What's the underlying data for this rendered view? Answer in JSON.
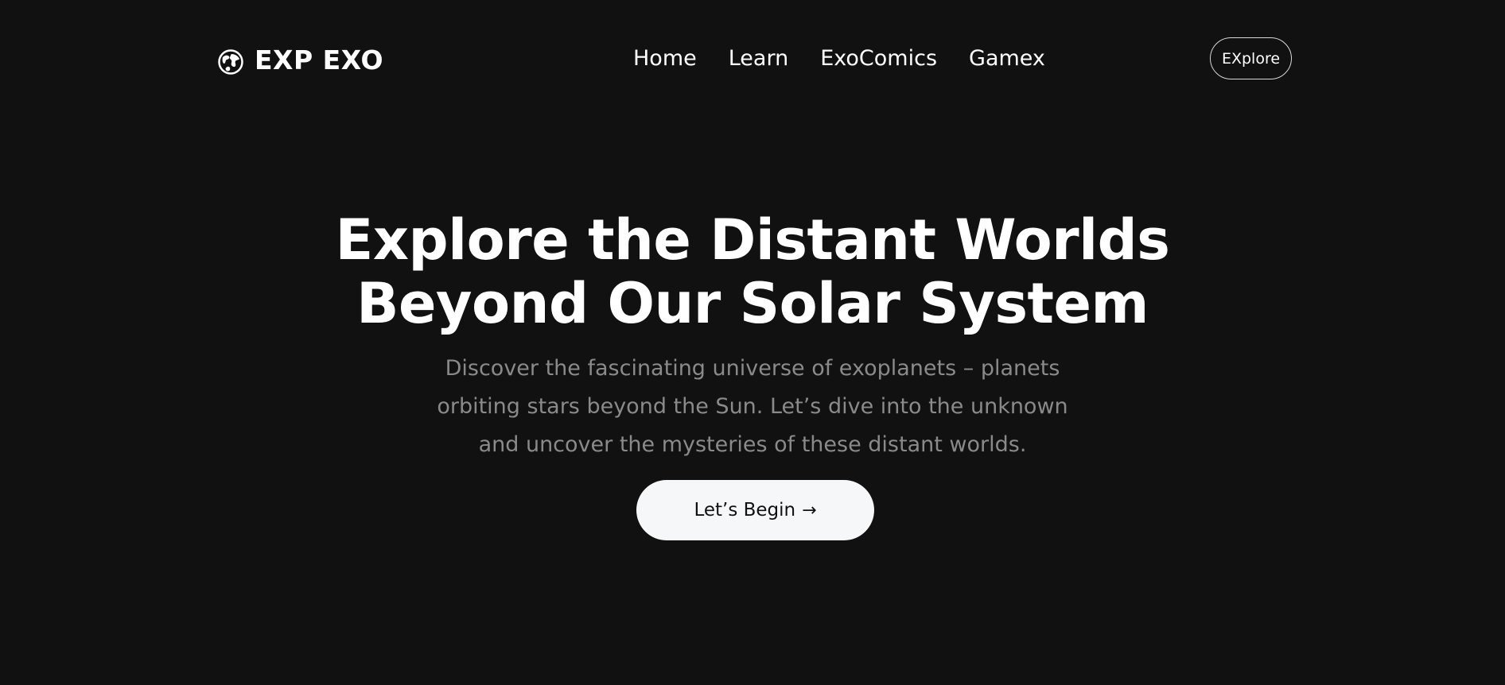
{
  "header": {
    "brand": {
      "icon": "globe-icon",
      "name": "EXP EXO"
    },
    "nav": [
      {
        "label": "Home"
      },
      {
        "label": "Learn"
      },
      {
        "label": "ExoComics"
      },
      {
        "label": "Gamex"
      }
    ],
    "cta_label": "EXplore"
  },
  "hero": {
    "title_line1": "Explore the Distant Worlds",
    "title_line2": "Beyond Our Solar System",
    "subtitle_line1": "Discover the fascinating universe of exoplanets – planets",
    "subtitle_line2": "orbiting stars beyond the Sun. Let’s dive into the unknown",
    "subtitle_line3": "and uncover the mysteries of these distant worlds.",
    "button_label": "Let’s Begin",
    "button_icon": "arrow-right-icon",
    "button_arrow": "→"
  },
  "colors": {
    "background": "#111111",
    "text": "#ffffff",
    "subtitle": "#8a8a8a",
    "button_bg": "#f6f7f9",
    "button_text": "#111111",
    "outline": "#d9d9d9"
  }
}
